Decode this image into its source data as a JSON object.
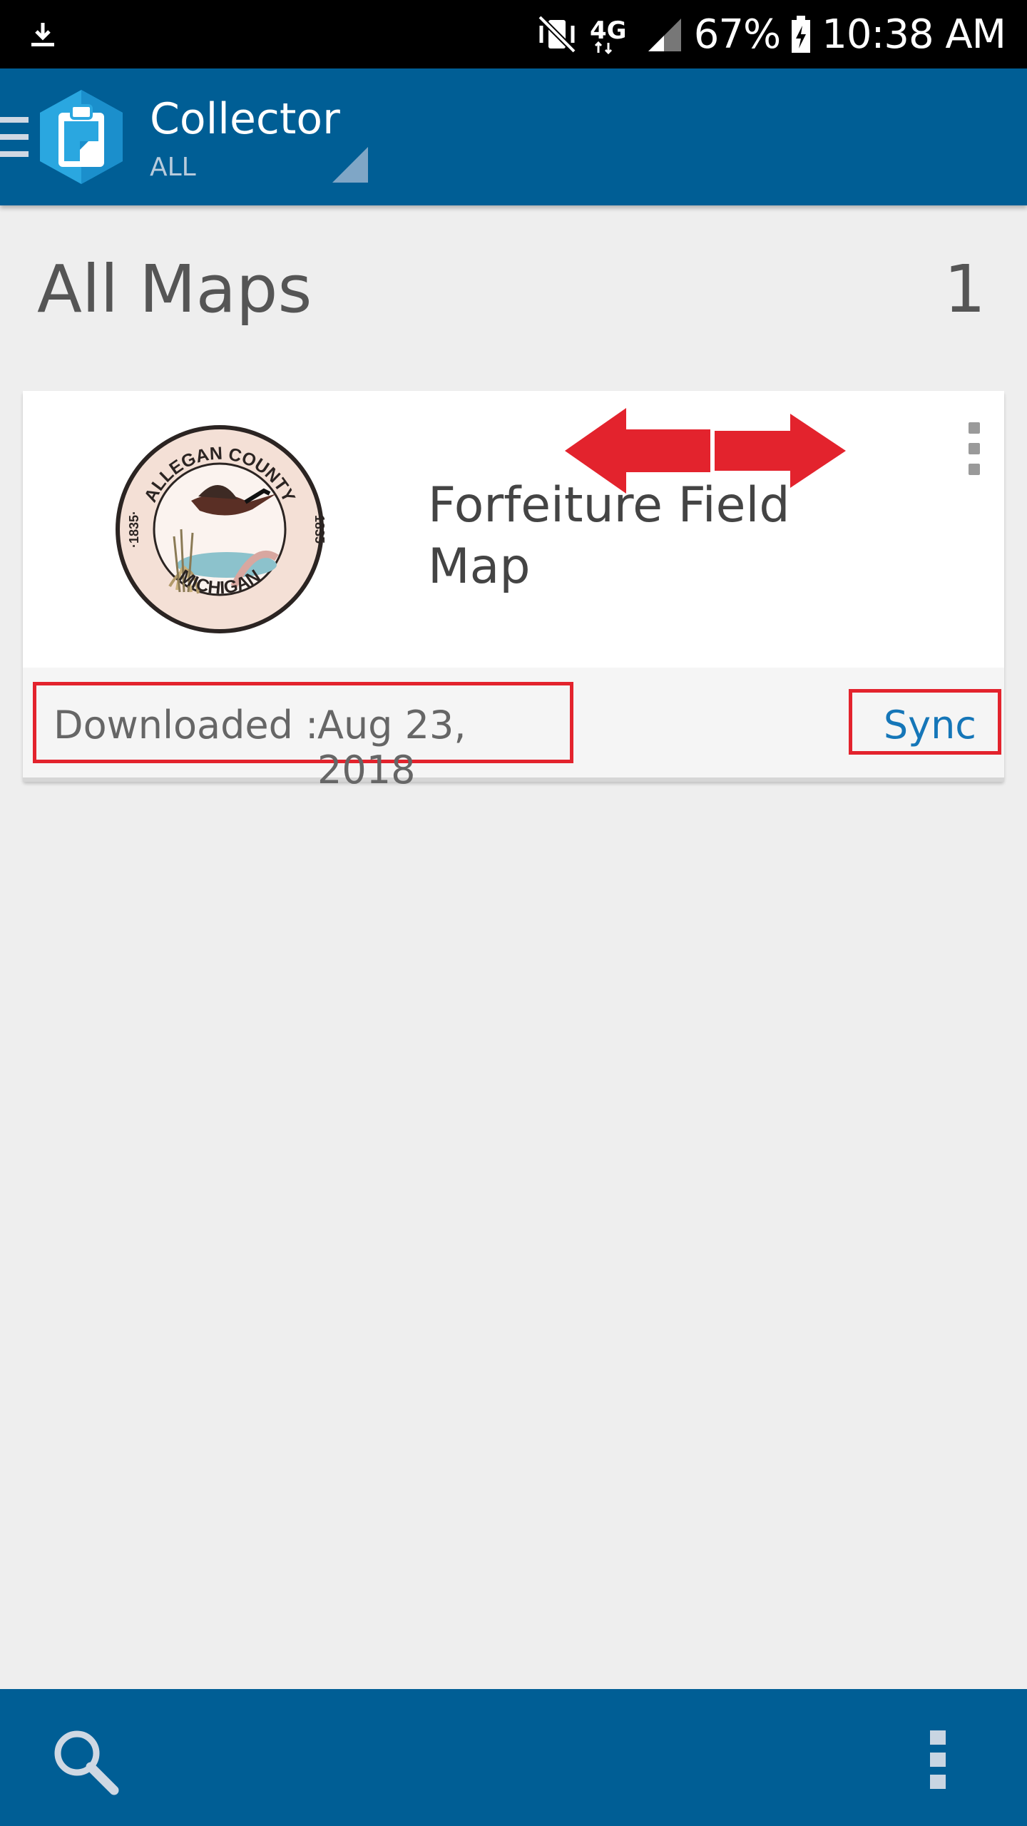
{
  "status_bar": {
    "battery": "67%",
    "time": "10:38 AM",
    "network": "4G",
    "icons": [
      "download-icon",
      "vibrate-mute-icon",
      "4g-lte-icon",
      "signal-icon",
      "battery-charging-icon"
    ]
  },
  "app_bar": {
    "title": "Collector",
    "subtitle": "ALL",
    "background": "#005e95"
  },
  "main": {
    "heading": "All Maps",
    "count": "1"
  },
  "map_card": {
    "logo": {
      "top_text": "ALLEGAN COUNTY",
      "bottom_text": "MICHIGAN",
      "year_left": "·1835·",
      "year_right": "·1835·"
    },
    "title": "Forfeiture Field Map",
    "downloaded_label": "Downloaded :",
    "downloaded_date": "Aug 23, 2018",
    "sync_label": "Sync",
    "annotation_color": "#e3232d",
    "link_color": "#1576b8"
  },
  "bottom_bar": {
    "icons": [
      "search-icon",
      "overflow-menu-icon"
    ]
  }
}
